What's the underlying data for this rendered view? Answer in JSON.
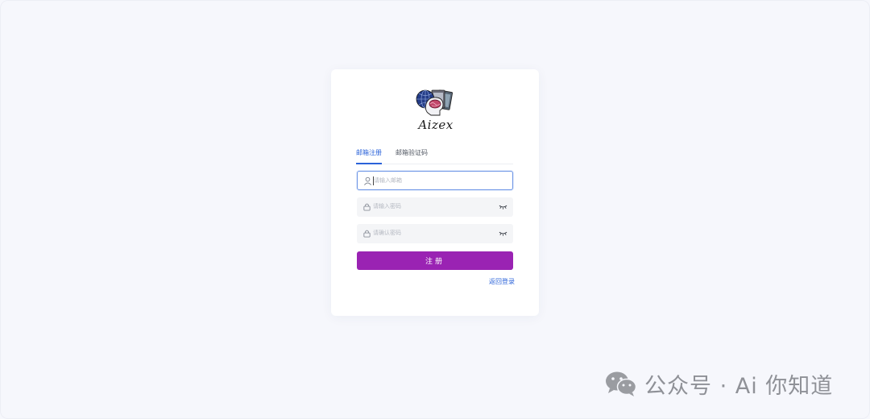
{
  "brand": {
    "logo_text": "Aizex"
  },
  "tabs": [
    {
      "label": "邮箱注册",
      "active": true
    },
    {
      "label": "邮箱验证码",
      "active": false
    }
  ],
  "form": {
    "email": {
      "value": "",
      "placeholder": "请输入邮箱",
      "icon": "user-icon"
    },
    "password": {
      "value": "",
      "placeholder": "请输入密码",
      "icon": "lock-icon"
    },
    "confirm_password": {
      "value": "",
      "placeholder": "请确认密码",
      "icon": "lock-icon"
    },
    "submit_label": "注册",
    "back_link_label": "返回登录"
  },
  "watermark": {
    "text": "公众号 · Ai 你知道",
    "icon": "wechat-icon"
  },
  "colors": {
    "background": "#f6f7fc",
    "accent_blue": "#2b63d9",
    "submit_purple": "#9a23b3",
    "input_focus_border": "#6d95e6"
  }
}
